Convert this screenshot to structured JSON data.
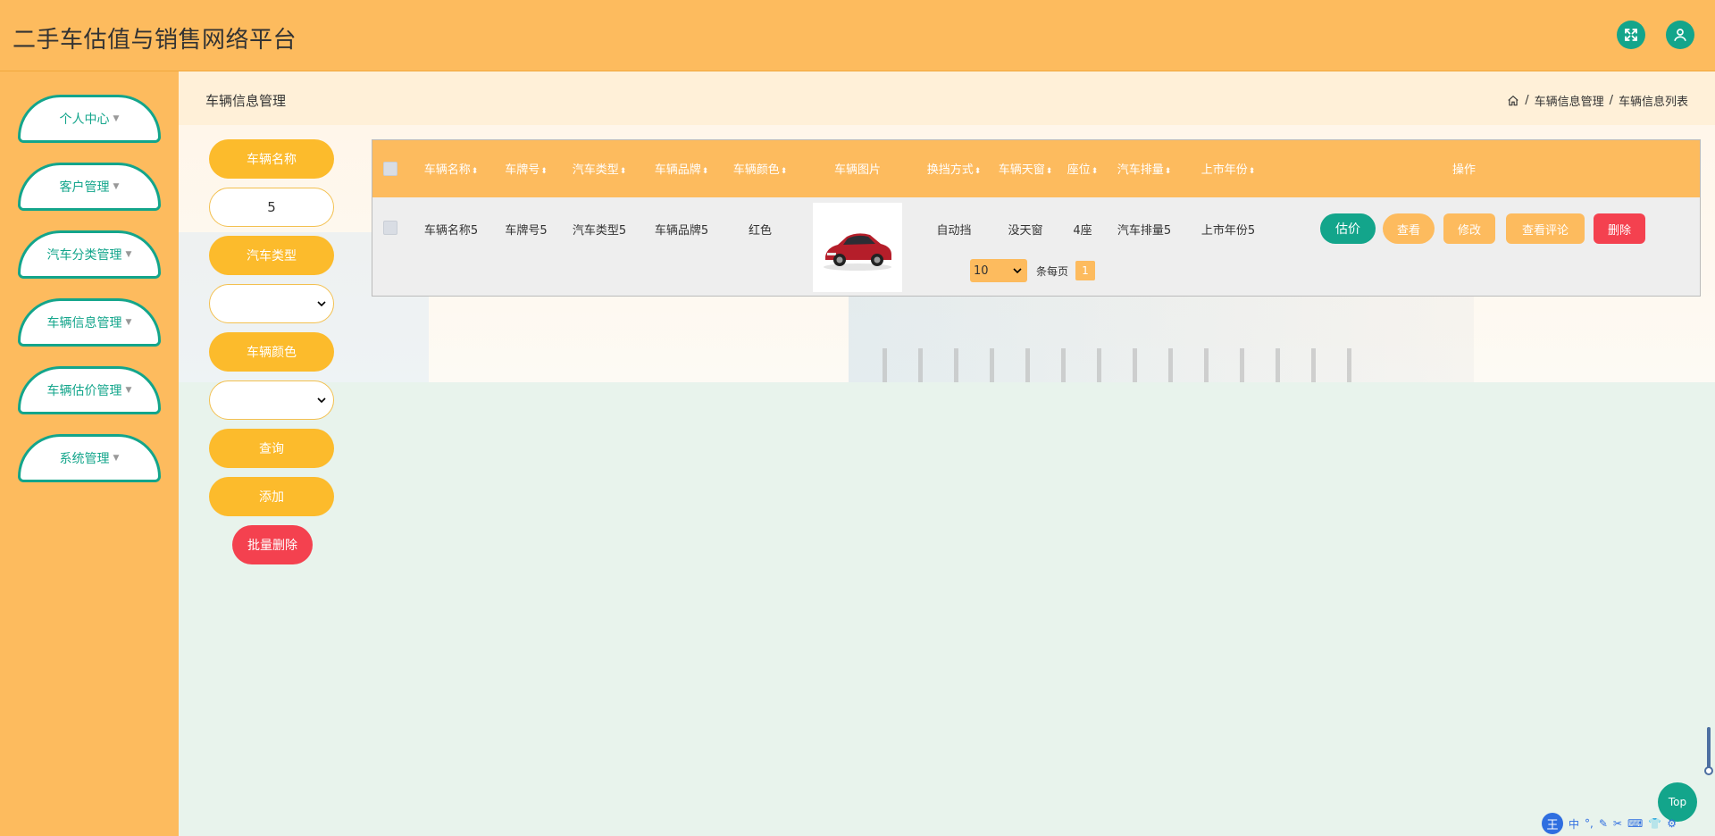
{
  "app_title": "二手车估值与销售网络平台",
  "header_icons": [
    "fullscreen-icon",
    "user-icon"
  ],
  "sidebar": {
    "items": [
      {
        "label": "个人中心"
      },
      {
        "label": "客户管理"
      },
      {
        "label": "汽车分类管理"
      },
      {
        "label": "车辆信息管理"
      },
      {
        "label": "车辆估价管理"
      },
      {
        "label": "系统管理"
      }
    ]
  },
  "page_title": "车辆信息管理",
  "breadcrumb": {
    "home_icon": "home-icon",
    "items": [
      "车辆信息管理",
      "车辆信息列表"
    ],
    "separator": "/"
  },
  "search": {
    "name_label": "车辆名称",
    "name_value": "5",
    "type_label": "汽车类型",
    "color_label": "车辆颜色",
    "query_button": "查询",
    "add_button": "添加",
    "batch_delete_button": "批量删除"
  },
  "table": {
    "columns": [
      "车辆名称",
      "车牌号",
      "汽车类型",
      "车辆品牌",
      "车辆颜色",
      "车辆图片",
      "换挡方式",
      "车辆天窗",
      "座位",
      "汽车排量",
      "上市年份",
      "操作"
    ],
    "sort_glyph": "⬍",
    "rows": [
      {
        "name": "车辆名称5",
        "plate": "车牌号5",
        "type": "汽车类型5",
        "brand": "车辆品牌5",
        "color": "红色",
        "gear": "自动挡",
        "sunroof": "没天窗",
        "seats": "4座",
        "displacement": "汽车排量5",
        "year": "上市年份5",
        "ops": [
          "估价",
          "查看",
          "修改",
          "查看评论",
          "删除"
        ]
      }
    ]
  },
  "pagination": {
    "page_size": "10",
    "per_page_label": "条每页",
    "current_page": "1"
  },
  "top_button": "Top",
  "ime": {
    "logo": "王",
    "items": [
      "中",
      "°,",
      "✎",
      "✂",
      "⌨",
      "👕",
      "⚙"
    ]
  },
  "colors": {
    "header_bg": "#fdbb5e",
    "accent_green": "#13a58b",
    "pill_yellow": "#fcbb2c",
    "delete_red": "#f4414f",
    "op_orange": "#fdbb5e"
  }
}
